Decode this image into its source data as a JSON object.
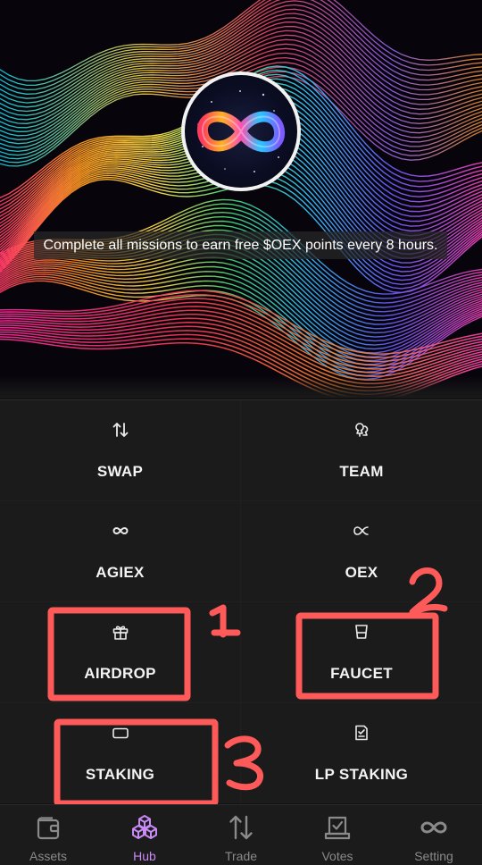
{
  "hero": {
    "mission_text": "Complete all missions to earn free $OEX points every 8 hours."
  },
  "tiles": [
    {
      "label": "SWAP",
      "icon": "swap-arrows-icon"
    },
    {
      "label": "TEAM",
      "icon": "team-icon"
    },
    {
      "label": "AGIEX",
      "icon": "infinity-icon"
    },
    {
      "label": "OEX",
      "icon": "proportional-icon"
    },
    {
      "label": "AIRDROP",
      "icon": "gift-icon"
    },
    {
      "label": "FAUCET",
      "icon": "cup-icon"
    },
    {
      "label": "STAKING",
      "icon": "wallet-icon"
    },
    {
      "label": "LP STAKING",
      "icon": "receipt-icon"
    }
  ],
  "annotations": [
    "1",
    "2",
    "3"
  ],
  "nav": {
    "items": [
      {
        "label": "Assets",
        "icon": "wallet-icon"
      },
      {
        "label": "Hub",
        "icon": "cubes-icon"
      },
      {
        "label": "Trade",
        "icon": "swap-arrows-icon"
      },
      {
        "label": "Votes",
        "icon": "vote-box-icon"
      },
      {
        "label": "Setting",
        "icon": "infinity-icon"
      }
    ],
    "active": "Hub"
  },
  "colors": {
    "background": "#121212",
    "tile": "#1b1b1b",
    "annotation": "#ff5a5a",
    "nav_active": "#c98af5",
    "nav_inactive": "#8a8a8a"
  }
}
